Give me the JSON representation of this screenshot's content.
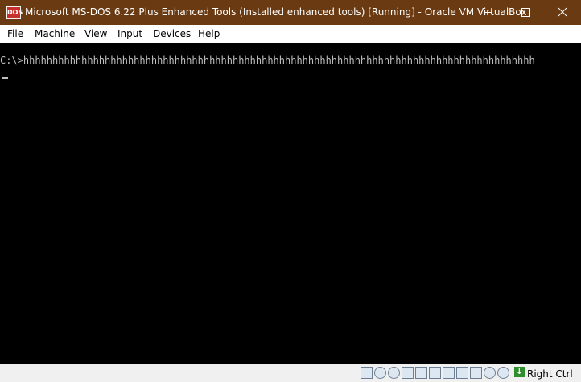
{
  "window": {
    "title": "Microsoft MS-DOS 6.22 Plus Enhanced Tools (Installed enhanced tools) [Running] - Oracle VM VirtualBox",
    "app_icon_text": "DOS"
  },
  "menu": [
    "File",
    "Machine",
    "View",
    "Input",
    "Devices",
    "Help"
  ],
  "screen": {
    "prompt": "C:\\>hhhhhhhhhhhhhhhhhhhhhhhhhhhhhhhhhhhhhhhhhhhhhhhhhhhhhhhhhhhhhhhhhhhhhhhhhhhhhhhhhhhhhhhh"
  },
  "status": {
    "host_key": "Right Ctrl",
    "icons": [
      "harddisk-icon",
      "optical-disk-icon",
      "audio-icon",
      "network-icon",
      "usb-icon",
      "shared-folder-icon",
      "display-icon",
      "video-capture-icon",
      "cpu-icon",
      "mouse-integration-icon",
      "keyboard-capture-icon"
    ]
  },
  "colors": {
    "titlebar": "#6a3a12",
    "screen_bg": "#000000",
    "screen_text": "#bfbfbf",
    "menubar_bg": "#ffffff",
    "statusbar_bg": "#f0f0f0"
  }
}
